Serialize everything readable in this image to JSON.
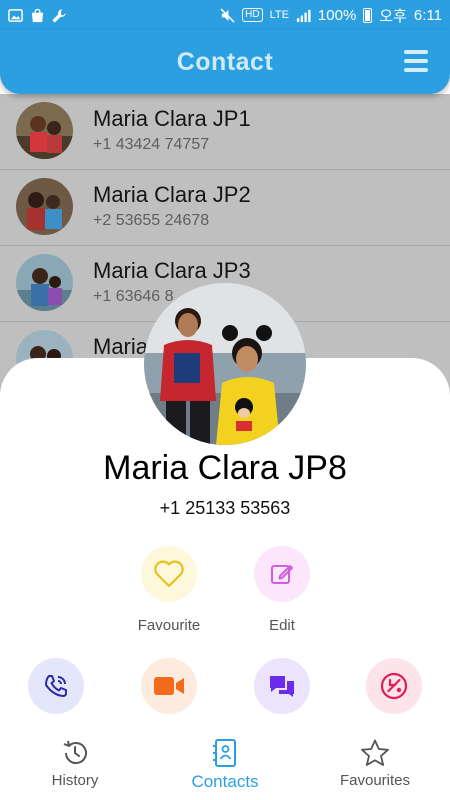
{
  "status_bar": {
    "network": "LTE",
    "hd": "HD",
    "battery": "100%",
    "ampm": "오후",
    "time": "6:11"
  },
  "header": {
    "title": "Contact"
  },
  "contacts": [
    {
      "name": "Maria Clara JP1",
      "phone": "+1 43424 74757"
    },
    {
      "name": "Maria Clara JP2",
      "phone": "+2 53655 24678"
    },
    {
      "name": "Maria Clara JP3",
      "phone": "+1 63646 8"
    },
    {
      "name": "Maria"
    }
  ],
  "selected_contact": {
    "name": "Maria Clara JP8",
    "phone": "+1 25133 53563"
  },
  "actions": {
    "favourite_label": "Favourite",
    "edit_label": "Edit"
  },
  "bottom_nav": {
    "history": "History",
    "contacts": "Contacts",
    "favourites": "Favourites"
  },
  "colors": {
    "accent": "#2c9fe0",
    "favourite_icon": "#e8c21a",
    "edit_icon": "#d35de0",
    "call_icon": "#2d2aa8",
    "video_icon": "#f26a1b",
    "message_icon": "#6a2ce8",
    "block_icon": "#e01d57"
  }
}
